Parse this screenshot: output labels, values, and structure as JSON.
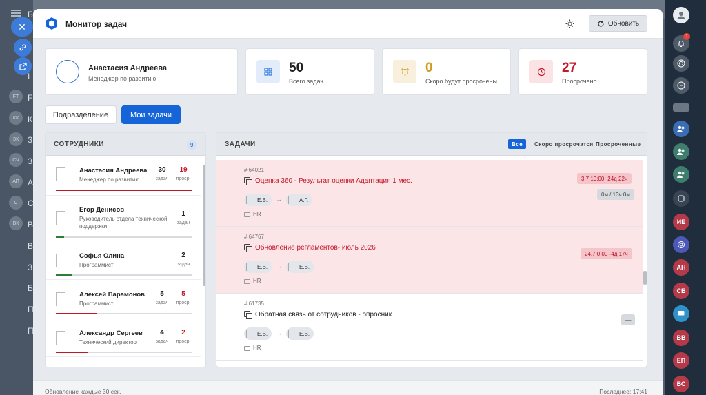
{
  "colors": {
    "primary": "#1565d8",
    "danger": "#c4182a",
    "warning": "#d09a1a",
    "overdue_bg": "#fbe5e7"
  },
  "background": {
    "sidebar_letters": [
      "Б",
      "I",
      "F",
      "К",
      "З",
      "З",
      "А",
      "С",
      "В",
      "В",
      "З",
      "Б",
      "П",
      "П"
    ],
    "badges": [
      "FT",
      "КК",
      "ЗК",
      "СЧ",
      "АП",
      "С",
      "ВК"
    ]
  },
  "rail": {
    "notification_count": "1",
    "avatars": [
      "ИЕ",
      "АН",
      "СБ",
      "ВВ",
      "ЕП",
      "ВС"
    ]
  },
  "modal": {
    "title": "Монитор задач",
    "refresh_label": "Обновить",
    "icons": {
      "logo": "hexagon-icon",
      "theme": "sun-icon",
      "refresh": "refresh-icon"
    }
  },
  "user": {
    "name": "Анастасия Андреева",
    "role": "Менеджер по развитию"
  },
  "stats": [
    {
      "value": "50",
      "label": "Всего задач",
      "color": "#1565d8",
      "icon": "grid-icon"
    },
    {
      "value": "0",
      "label": "Скоро будут просрочены",
      "color": "#d09a1a",
      "icon": "bell-icon"
    },
    {
      "value": "27",
      "label": "Просрочено",
      "color": "#c4182a",
      "icon": "clock-icon"
    }
  ],
  "tabs": {
    "department": "Подразделение",
    "my_tasks": "Мои задачи"
  },
  "employees": {
    "title": "СОТРУДНИКИ",
    "count": "9",
    "tasks_label": "задач",
    "overdue_label": "проср.",
    "items": [
      {
        "name": "Анастасия Андреева",
        "role": "Менеджер по развитию",
        "tasks": "30",
        "overdue": "19",
        "progress": 1.0,
        "bar_color": "#c4182a"
      },
      {
        "name": "Егор Денисов",
        "role": "Руководитель отдела технической поддержки",
        "tasks": "1",
        "overdue": "",
        "progress": 0.06,
        "bar_color": "#2e7d32"
      },
      {
        "name": "Софья Олина",
        "role": "Программист",
        "tasks": "2",
        "overdue": "",
        "progress": 0.12,
        "bar_color": "#2e7d32"
      },
      {
        "name": "Алексей Парамонов",
        "role": "Программист",
        "tasks": "5",
        "overdue": "5",
        "progress": 0.3,
        "bar_color": "#c4182a"
      },
      {
        "name": "Александр Сергеев",
        "role": "Технический директор",
        "tasks": "4",
        "overdue": "2",
        "progress": 0.24,
        "bar_color": "#c4182a"
      }
    ]
  },
  "tasks": {
    "title": "ЗАДАЧИ",
    "filters": [
      "Все",
      "Скоро просрочатся",
      "Просроченные"
    ],
    "items": [
      {
        "id": "64021",
        "title": "Оценка 360 - Результат оценки Адаптация 1 мес.",
        "from": "Е.В.",
        "to": "А.Г.",
        "category": "HR",
        "deadline": "3.7 19:00 -24д 22ч",
        "time": "0м / 13ч 0м",
        "overdue": true
      },
      {
        "id": "64767",
        "title": "Обновление регламентов- июль 2026",
        "from": "Е.В.",
        "to": "Е.В.",
        "category": "HR",
        "deadline": "24.7 0:00 -4д 17ч",
        "time": "",
        "overdue": true
      },
      {
        "id": "61735",
        "title": "Обратная связь от сотрудников - опросник",
        "from": "Е.В.",
        "to": "Е.В.",
        "category": "HR",
        "deadline": "",
        "time": "—",
        "overdue": false
      }
    ]
  },
  "footer": {
    "update_note": "Обновление каждые 30 сек.",
    "last_update": "Последнее: 17:41"
  }
}
